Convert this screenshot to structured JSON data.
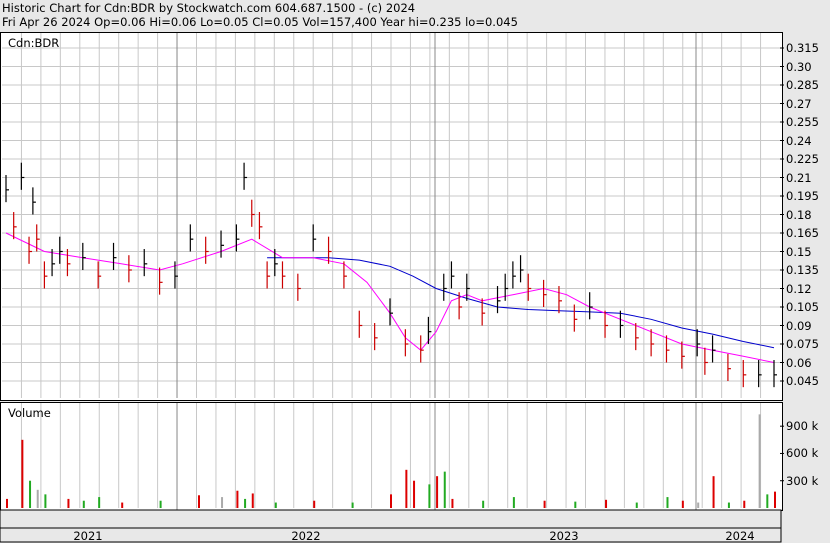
{
  "header": {
    "line1": "Historic Chart for Cdn:BDR by Stockwatch.com 604.687.1500 - (c) 2024",
    "line2": "Fri Apr 26 2024   Op=0.06   Hi=0.06   Lo=0.05   Cl=0.05   Vol=157,400   Year hi=0.235   lo=0.045"
  },
  "colors": {
    "price_up": "#000000",
    "price_down": "#cc0000",
    "ma_short": "#ff00ff",
    "ma_long": "#0000cc",
    "vol_up": "#22aa22",
    "vol_down": "#dd0000",
    "vol_flat": "#aaaaaa",
    "grid": "#c8c8c8"
  },
  "chart_data": {
    "type": "line",
    "symbol": "Cdn:BDR",
    "price_panel": {
      "label": "Cdn:BDR",
      "ylim": [
        0.04,
        0.32
      ],
      "yticks": [
        "0.315",
        "0.30",
        "0.285",
        "0.27",
        "0.255",
        "0.24",
        "0.225",
        "0.21",
        "0.195",
        "0.18",
        "0.165",
        "0.15",
        "0.135",
        "0.12",
        "0.105",
        "0.09",
        "0.075",
        "0.06",
        "0.045"
      ],
      "grid": true
    },
    "volume_panel": {
      "label": "Volume",
      "yticks": [
        "900 k",
        "600 k",
        "300 k"
      ]
    },
    "x_axis": {
      "labels": [
        "2021",
        "2022",
        "2023",
        "2024"
      ]
    },
    "series": [
      {
        "type": "ohlc",
        "points": [
          [
            0.0,
            0.2
          ],
          [
            0.01,
            0.17
          ],
          [
            0.02,
            0.21
          ],
          [
            0.03,
            0.15
          ],
          [
            0.035,
            0.19
          ],
          [
            0.04,
            0.16
          ],
          [
            0.05,
            0.13
          ],
          [
            0.06,
            0.14
          ],
          [
            0.07,
            0.15
          ],
          [
            0.08,
            0.14
          ],
          [
            0.1,
            0.145
          ],
          [
            0.12,
            0.13
          ],
          [
            0.14,
            0.145
          ],
          [
            0.16,
            0.135
          ],
          [
            0.18,
            0.14
          ],
          [
            0.2,
            0.125
          ],
          [
            0.22,
            0.13
          ],
          [
            0.24,
            0.16
          ],
          [
            0.26,
            0.15
          ],
          [
            0.28,
            0.155
          ],
          [
            0.3,
            0.16
          ],
          [
            0.31,
            0.21
          ],
          [
            0.32,
            0.18
          ],
          [
            0.33,
            0.17
          ],
          [
            0.34,
            0.13
          ],
          [
            0.35,
            0.14
          ],
          [
            0.36,
            0.13
          ],
          [
            0.38,
            0.12
          ],
          [
            0.4,
            0.16
          ],
          [
            0.42,
            0.15
          ],
          [
            0.44,
            0.13
          ],
          [
            0.46,
            0.09
          ],
          [
            0.48,
            0.08
          ],
          [
            0.5,
            0.1
          ],
          [
            0.52,
            0.075
          ],
          [
            0.54,
            0.07
          ],
          [
            0.55,
            0.085
          ],
          [
            0.57,
            0.12
          ],
          [
            0.58,
            0.13
          ],
          [
            0.59,
            0.105
          ],
          [
            0.6,
            0.12
          ],
          [
            0.62,
            0.1
          ],
          [
            0.64,
            0.11
          ],
          [
            0.65,
            0.12
          ],
          [
            0.66,
            0.13
          ],
          [
            0.67,
            0.135
          ],
          [
            0.68,
            0.12
          ],
          [
            0.7,
            0.115
          ],
          [
            0.72,
            0.11
          ],
          [
            0.74,
            0.095
          ],
          [
            0.76,
            0.105
          ],
          [
            0.78,
            0.09
          ],
          [
            0.8,
            0.09
          ],
          [
            0.82,
            0.08
          ],
          [
            0.84,
            0.075
          ],
          [
            0.86,
            0.07
          ],
          [
            0.88,
            0.065
          ],
          [
            0.9,
            0.075
          ],
          [
            0.91,
            0.06
          ],
          [
            0.92,
            0.07
          ],
          [
            0.94,
            0.055
          ],
          [
            0.96,
            0.05
          ],
          [
            0.98,
            0.05
          ],
          [
            1.0,
            0.05
          ]
        ]
      },
      {
        "type": "ma_short",
        "points": [
          [
            0,
            0.165
          ],
          [
            0.05,
            0.15
          ],
          [
            0.1,
            0.145
          ],
          [
            0.15,
            0.14
          ],
          [
            0.2,
            0.135
          ],
          [
            0.23,
            0.14
          ],
          [
            0.28,
            0.15
          ],
          [
            0.32,
            0.16
          ],
          [
            0.36,
            0.145
          ],
          [
            0.4,
            0.145
          ],
          [
            0.44,
            0.14
          ],
          [
            0.47,
            0.125
          ],
          [
            0.5,
            0.1
          ],
          [
            0.52,
            0.08
          ],
          [
            0.54,
            0.07
          ],
          [
            0.56,
            0.085
          ],
          [
            0.58,
            0.11
          ],
          [
            0.6,
            0.115
          ],
          [
            0.62,
            0.11
          ],
          [
            0.66,
            0.115
          ],
          [
            0.7,
            0.12
          ],
          [
            0.73,
            0.115
          ],
          [
            0.76,
            0.105
          ],
          [
            0.8,
            0.095
          ],
          [
            0.84,
            0.085
          ],
          [
            0.88,
            0.075
          ],
          [
            0.92,
            0.07
          ],
          [
            0.96,
            0.065
          ],
          [
            1.0,
            0.06
          ]
        ]
      },
      {
        "type": "ma_long",
        "points": [
          [
            0.34,
            0.145
          ],
          [
            0.38,
            0.145
          ],
          [
            0.42,
            0.145
          ],
          [
            0.46,
            0.143
          ],
          [
            0.5,
            0.138
          ],
          [
            0.53,
            0.13
          ],
          [
            0.56,
            0.12
          ],
          [
            0.6,
            0.112
          ],
          [
            0.64,
            0.105
          ],
          [
            0.68,
            0.103
          ],
          [
            0.72,
            0.102
          ],
          [
            0.76,
            0.101
          ],
          [
            0.8,
            0.1
          ],
          [
            0.84,
            0.095
          ],
          [
            0.88,
            0.088
          ],
          [
            0.92,
            0.083
          ],
          [
            0.96,
            0.077
          ],
          [
            1.0,
            0.072
          ]
        ]
      }
    ],
    "volume_k": [
      [
        0.0,
        100,
        "d"
      ],
      [
        0.02,
        750,
        "d"
      ],
      [
        0.03,
        300,
        "u"
      ],
      [
        0.04,
        200,
        "f"
      ],
      [
        0.05,
        150,
        "u"
      ],
      [
        0.08,
        100,
        "d"
      ],
      [
        0.1,
        80,
        "u"
      ],
      [
        0.12,
        120,
        "u"
      ],
      [
        0.15,
        60,
        "d"
      ],
      [
        0.2,
        80,
        "u"
      ],
      [
        0.25,
        140,
        "d"
      ],
      [
        0.28,
        120,
        "f"
      ],
      [
        0.3,
        190,
        "d"
      ],
      [
        0.31,
        100,
        "u"
      ],
      [
        0.32,
        160,
        "d"
      ],
      [
        0.35,
        60,
        "u"
      ],
      [
        0.4,
        80,
        "d"
      ],
      [
        0.45,
        60,
        "u"
      ],
      [
        0.5,
        150,
        "d"
      ],
      [
        0.52,
        420,
        "d"
      ],
      [
        0.53,
        300,
        "d"
      ],
      [
        0.55,
        260,
        "u"
      ],
      [
        0.56,
        350,
        "d"
      ],
      [
        0.57,
        400,
        "u"
      ],
      [
        0.58,
        100,
        "d"
      ],
      [
        0.62,
        80,
        "u"
      ],
      [
        0.66,
        120,
        "u"
      ],
      [
        0.7,
        80,
        "d"
      ],
      [
        0.74,
        70,
        "u"
      ],
      [
        0.78,
        90,
        "d"
      ],
      [
        0.82,
        60,
        "u"
      ],
      [
        0.86,
        120,
        "u"
      ],
      [
        0.88,
        80,
        "d"
      ],
      [
        0.9,
        60,
        "f"
      ],
      [
        0.92,
        350,
        "d"
      ],
      [
        0.94,
        60,
        "u"
      ],
      [
        0.96,
        80,
        "d"
      ],
      [
        0.98,
        1030,
        "f"
      ],
      [
        0.99,
        150,
        "u"
      ],
      [
        1.0,
        180,
        "d"
      ]
    ]
  }
}
